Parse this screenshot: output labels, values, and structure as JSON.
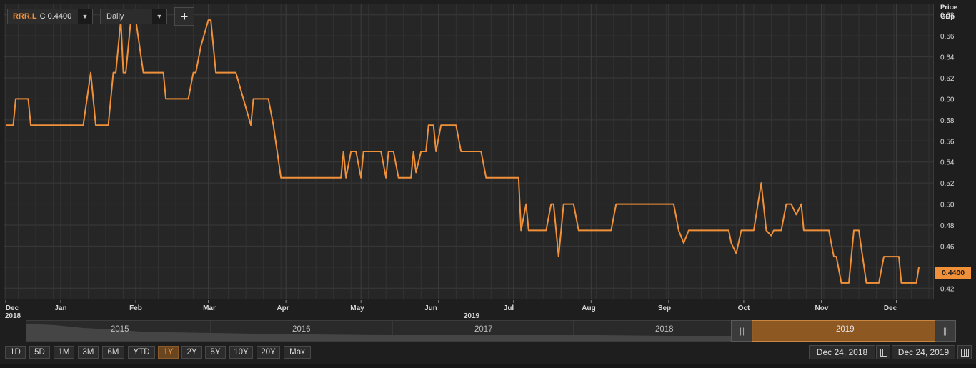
{
  "toolbar": {
    "symbol": "RRR.L",
    "close_label": "C 0.4400",
    "interval": "Daily",
    "add_label": "+"
  },
  "axis": {
    "price_title": "Price",
    "currency": "GBp",
    "last_price": "0.4400",
    "x_year_label": "2019",
    "x_start_label_month": "Dec",
    "x_start_label_year": "2018"
  },
  "navigator": {
    "years": [
      "2015",
      "2016",
      "2017",
      "2018",
      "2019"
    ]
  },
  "range_buttons": [
    "1D",
    "5D",
    "1M",
    "3M",
    "6M",
    "YTD",
    "1Y",
    "2Y",
    "5Y",
    "10Y",
    "20Y",
    "Max"
  ],
  "active_range": "1Y",
  "date_range": {
    "from": "Dec 24, 2018",
    "to": "Dec 24, 2019"
  },
  "colors": {
    "line": "#f0913a",
    "accent": "#f0913a",
    "background": "#262626",
    "grid": "#3a3a3a"
  },
  "chart_data": {
    "type": "line",
    "title": "",
    "xlabel": "",
    "ylabel": "Price GBp",
    "grid": true,
    "ylim": [
      0.41,
      0.69
    ],
    "xlim": [
      "2018-12-24",
      "2019-12-24"
    ],
    "yticks": [
      0.42,
      0.44,
      0.46,
      0.48,
      0.5,
      0.52,
      0.54,
      0.56,
      0.58,
      0.6,
      0.62,
      0.64,
      0.66,
      0.68
    ],
    "ytick_labels": [
      "0.42",
      "",
      "0.46",
      "0.48",
      "0.50",
      "0.52",
      "0.54",
      "0.56",
      "0.58",
      "0.60",
      "0.62",
      "0.64",
      "0.66",
      "0.68"
    ],
    "month_ticks": [
      {
        "label": "Dec",
        "date": "2018-12-24"
      },
      {
        "label": "Jan",
        "date": "2019-01-15"
      },
      {
        "label": "Feb",
        "date": "2019-02-14"
      },
      {
        "label": "Mar",
        "date": "2019-03-15"
      },
      {
        "label": "Apr",
        "date": "2019-04-15"
      },
      {
        "label": "May",
        "date": "2019-05-15"
      },
      {
        "label": "Jun",
        "date": "2019-06-15"
      },
      {
        "label": "Jul",
        "date": "2019-07-15"
      },
      {
        "label": "Aug",
        "date": "2019-08-15"
      },
      {
        "label": "Sep",
        "date": "2019-09-15"
      },
      {
        "label": "Oct",
        "date": "2019-10-15"
      },
      {
        "label": "Nov",
        "date": "2019-11-15"
      },
      {
        "label": "Dec",
        "date": "2019-12-15"
      }
    ],
    "series": [
      {
        "name": "RRR.L",
        "points": [
          [
            "2018-12-24",
            0.575
          ],
          [
            "2018-12-27",
            0.575
          ],
          [
            "2018-12-28",
            0.6
          ],
          [
            "2019-01-02",
            0.6
          ],
          [
            "2019-01-03",
            0.575
          ],
          [
            "2019-01-24",
            0.575
          ],
          [
            "2019-01-27",
            0.625
          ],
          [
            "2019-01-29",
            0.575
          ],
          [
            "2019-02-03",
            0.575
          ],
          [
            "2019-02-05",
            0.625
          ],
          [
            "2019-02-06",
            0.625
          ],
          [
            "2019-02-08",
            0.675
          ],
          [
            "2019-02-09",
            0.625
          ],
          [
            "2019-02-10",
            0.625
          ],
          [
            "2019-02-12",
            0.675
          ],
          [
            "2019-02-14",
            0.675
          ],
          [
            "2019-02-17",
            0.625
          ],
          [
            "2019-02-25",
            0.625
          ],
          [
            "2019-02-26",
            0.6
          ],
          [
            "2019-03-07",
            0.6
          ],
          [
            "2019-03-09",
            0.625
          ],
          [
            "2019-03-10",
            0.625
          ],
          [
            "2019-03-12",
            0.65
          ],
          [
            "2019-03-15",
            0.675
          ],
          [
            "2019-03-16",
            0.675
          ],
          [
            "2019-03-18",
            0.625
          ],
          [
            "2019-03-23",
            0.625
          ],
          [
            "2019-03-26",
            0.625
          ],
          [
            "2019-04-01",
            0.575
          ],
          [
            "2019-04-02",
            0.6
          ],
          [
            "2019-04-08",
            0.6
          ],
          [
            "2019-04-10",
            0.575
          ],
          [
            "2019-04-13",
            0.525
          ],
          [
            "2019-04-16",
            0.525
          ],
          [
            "2019-05-07",
            0.525
          ],
          [
            "2019-05-08",
            0.55
          ],
          [
            "2019-05-09",
            0.525
          ],
          [
            "2019-05-11",
            0.55
          ],
          [
            "2019-05-13",
            0.55
          ],
          [
            "2019-05-15",
            0.525
          ],
          [
            "2019-05-16",
            0.55
          ],
          [
            "2019-05-23",
            0.55
          ],
          [
            "2019-05-25",
            0.525
          ],
          [
            "2019-05-26",
            0.55
          ],
          [
            "2019-05-28",
            0.55
          ],
          [
            "2019-05-30",
            0.525
          ],
          [
            "2019-06-04",
            0.525
          ],
          [
            "2019-06-05",
            0.55
          ],
          [
            "2019-06-06",
            0.53
          ],
          [
            "2019-06-08",
            0.55
          ],
          [
            "2019-06-10",
            0.55
          ],
          [
            "2019-06-11",
            0.575
          ],
          [
            "2019-06-13",
            0.575
          ],
          [
            "2019-06-14",
            0.55
          ],
          [
            "2019-06-16",
            0.575
          ],
          [
            "2019-06-22",
            0.575
          ],
          [
            "2019-06-24",
            0.55
          ],
          [
            "2019-07-02",
            0.55
          ],
          [
            "2019-07-04",
            0.525
          ],
          [
            "2019-07-17",
            0.525
          ],
          [
            "2019-07-18",
            0.475
          ],
          [
            "2019-07-20",
            0.5
          ],
          [
            "2019-07-21",
            0.475
          ],
          [
            "2019-07-28",
            0.475
          ],
          [
            "2019-07-30",
            0.5
          ],
          [
            "2019-07-31",
            0.5
          ],
          [
            "2019-08-02",
            0.45
          ],
          [
            "2019-08-04",
            0.5
          ],
          [
            "2019-08-08",
            0.5
          ],
          [
            "2019-08-10",
            0.475
          ],
          [
            "2019-08-23",
            0.475
          ],
          [
            "2019-08-25",
            0.5
          ],
          [
            "2019-09-17",
            0.5
          ],
          [
            "2019-09-19",
            0.475
          ],
          [
            "2019-09-21",
            0.463
          ],
          [
            "2019-09-23",
            0.475
          ],
          [
            "2019-10-09",
            0.475
          ],
          [
            "2019-10-10",
            0.463
          ],
          [
            "2019-10-12",
            0.453
          ],
          [
            "2019-10-14",
            0.475
          ],
          [
            "2019-10-19",
            0.475
          ],
          [
            "2019-10-22",
            0.52
          ],
          [
            "2019-10-24",
            0.475
          ],
          [
            "2019-10-26",
            0.47
          ],
          [
            "2019-10-27",
            0.475
          ],
          [
            "2019-10-30",
            0.475
          ],
          [
            "2019-11-01",
            0.5
          ],
          [
            "2019-11-03",
            0.5
          ],
          [
            "2019-11-05",
            0.49
          ],
          [
            "2019-11-07",
            0.5
          ],
          [
            "2019-11-08",
            0.475
          ],
          [
            "2019-11-18",
            0.475
          ],
          [
            "2019-11-20",
            0.45
          ],
          [
            "2019-11-21",
            0.45
          ],
          [
            "2019-11-23",
            0.425
          ],
          [
            "2019-11-26",
            0.425
          ],
          [
            "2019-11-28",
            0.475
          ],
          [
            "2019-11-30",
            0.475
          ],
          [
            "2019-12-03",
            0.425
          ],
          [
            "2019-12-08",
            0.425
          ],
          [
            "2019-12-10",
            0.45
          ],
          [
            "2019-12-16",
            0.45
          ],
          [
            "2019-12-17",
            0.425
          ],
          [
            "2019-12-22",
            0.425
          ],
          [
            "2019-12-23",
            0.425
          ],
          [
            "2019-12-24",
            0.44
          ]
        ]
      }
    ]
  }
}
